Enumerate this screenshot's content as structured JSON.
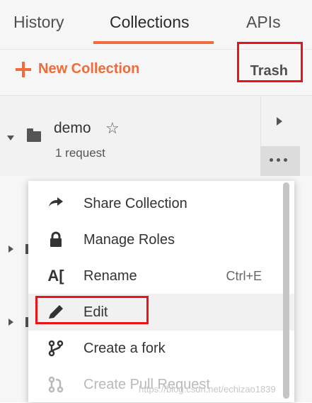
{
  "tabs": {
    "history": "History",
    "collections": "Collections",
    "apis": "APIs",
    "active": "Collections"
  },
  "toolbar": {
    "new_collection": "New Collection",
    "trash": "Trash"
  },
  "collection": {
    "name": "demo",
    "request_count": "1 request"
  },
  "menu": {
    "items": [
      {
        "label": "Share Collection",
        "icon": "share-arrow-icon",
        "shortcut": ""
      },
      {
        "label": "Manage Roles",
        "icon": "lock-icon",
        "shortcut": ""
      },
      {
        "label": "Rename",
        "icon": "rename-icon",
        "shortcut": "Ctrl+E"
      },
      {
        "label": "Edit",
        "icon": "pencil-icon",
        "shortcut": ""
      },
      {
        "label": "Create a fork",
        "icon": "fork-icon",
        "shortcut": ""
      },
      {
        "label": "Create Pull Request",
        "icon": "pull-request-icon",
        "shortcut": "",
        "disabled": true
      }
    ]
  },
  "colors": {
    "accent": "#f26b3a",
    "highlight": "#e8141a"
  },
  "watermark": "https://blog.csdn.net/echizao1839"
}
